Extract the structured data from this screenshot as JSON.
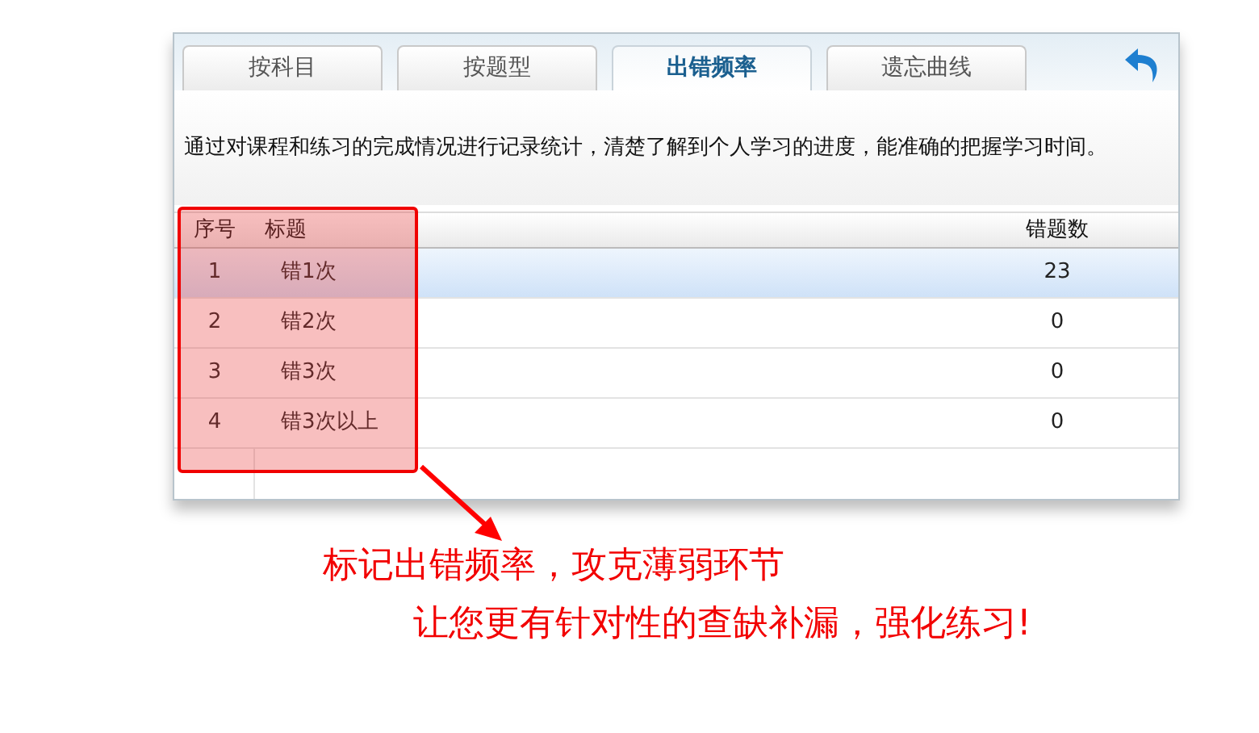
{
  "tabs": [
    {
      "label": "按科目",
      "selected": false
    },
    {
      "label": "按题型",
      "selected": false
    },
    {
      "label": "出错频率",
      "selected": true
    },
    {
      "label": "遗忘曲线",
      "selected": false
    }
  ],
  "description": "通过对课程和练习的完成情况进行记录统计，清楚了解到个人学习的进度，能准确的把握学习时间。",
  "table": {
    "columns": [
      "序号",
      "标题",
      "错题数"
    ],
    "rows": [
      {
        "cells": [
          "1",
          "错1次",
          "23"
        ],
        "selected": true
      },
      {
        "cells": [
          "2",
          "错2次",
          "0"
        ],
        "selected": false
      },
      {
        "cells": [
          "3",
          "错3次",
          "0"
        ],
        "selected": false
      },
      {
        "cells": [
          "4",
          "错3次以上",
          "0"
        ],
        "selected": false
      }
    ]
  },
  "caption": [
    "标记出错频率，攻克薄弱环节",
    "让您更有针对性的查缺补漏，强化练习!"
  ]
}
